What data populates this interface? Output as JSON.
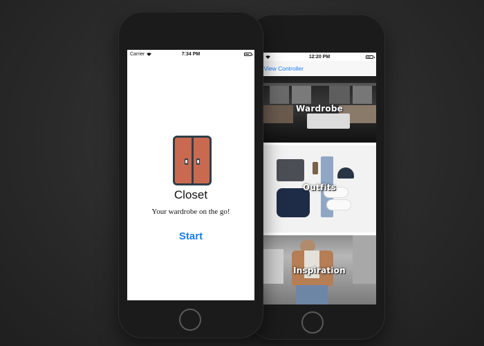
{
  "front_phone": {
    "status_bar": {
      "carrier": "Carrier",
      "time": "7:34 PM"
    },
    "app": {
      "title": "Closet",
      "tagline": "Your wardrobe on the go!",
      "start_label": "Start",
      "icon": "closet-icon"
    }
  },
  "back_phone": {
    "status_bar": {
      "time": "12:20 PM"
    },
    "nav": {
      "back_label": "ot View Controller"
    },
    "tiles": [
      {
        "label": "Wardrobe"
      },
      {
        "label": "Outfits"
      },
      {
        "label": "Inspiration"
      }
    ]
  },
  "colors": {
    "accent": "#1a7ef5",
    "closet_door": "#c96a50",
    "closet_frame": "#2f3e4a"
  }
}
